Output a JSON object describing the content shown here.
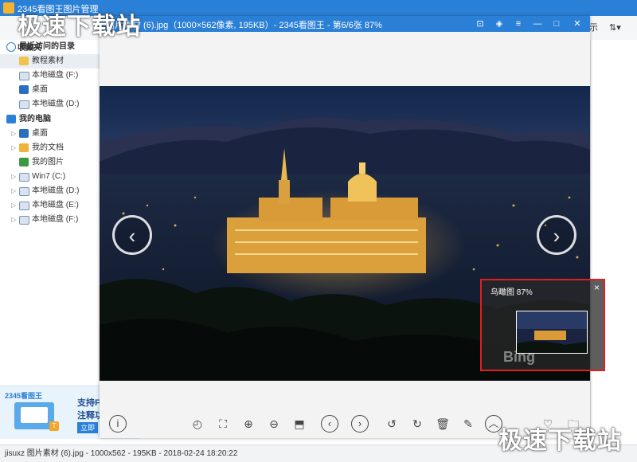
{
  "main_window": {
    "title": "2345看图王图片管理",
    "toolbar_right": {
      "label_fragment": "示"
    },
    "favorites": "收藏夹",
    "tree": {
      "recent_header": "最近访问的目录",
      "recent_items": [
        "教程素材",
        "本地磁盘 (F:)",
        "桌面",
        "本地磁盘 (D:)"
      ],
      "pc_header": "我的电脑",
      "pc_items": [
        "桌面",
        "我的文档",
        "我的图片",
        "Win7 (C:)",
        "本地磁盘 (D:)",
        "本地磁盘 (E:)",
        "本地磁盘 (F:)"
      ]
    },
    "ad": {
      "brand": "2345看图王",
      "line1": "支持F",
      "line2": "注释功",
      "button": "立即"
    },
    "statusbar": "jisuxz 图片素材 (6).jpg - 1000x562 - 195KB - 2018-02-24 18:20:22"
  },
  "viewer": {
    "title": "图片素材 (6).jpg（1000×562像素, 195KB）- 2345看图王 - 第6/6张 87%",
    "navigator": {
      "title": "鸟瞰图 87%",
      "close": "×",
      "watermark": "Bing"
    },
    "toolbar_icons": [
      "info-icon",
      "rotate-view-icon",
      "crop-icon",
      "zoom-in-icon",
      "zoom-out-icon",
      "bookmark-icon",
      "prev-icon",
      "next-icon",
      "rotate-left-icon",
      "rotate-right-icon",
      "delete-icon",
      "edit-icon",
      "more-icon",
      "favorite-icon",
      "folder-icon"
    ]
  },
  "watermark": {
    "top": "极速下载站",
    "bottom": "极速下载站"
  },
  "colors": {
    "titlebar": "#2a7fd6",
    "highlight": "#e02020",
    "accent": "#2a7fd6"
  }
}
